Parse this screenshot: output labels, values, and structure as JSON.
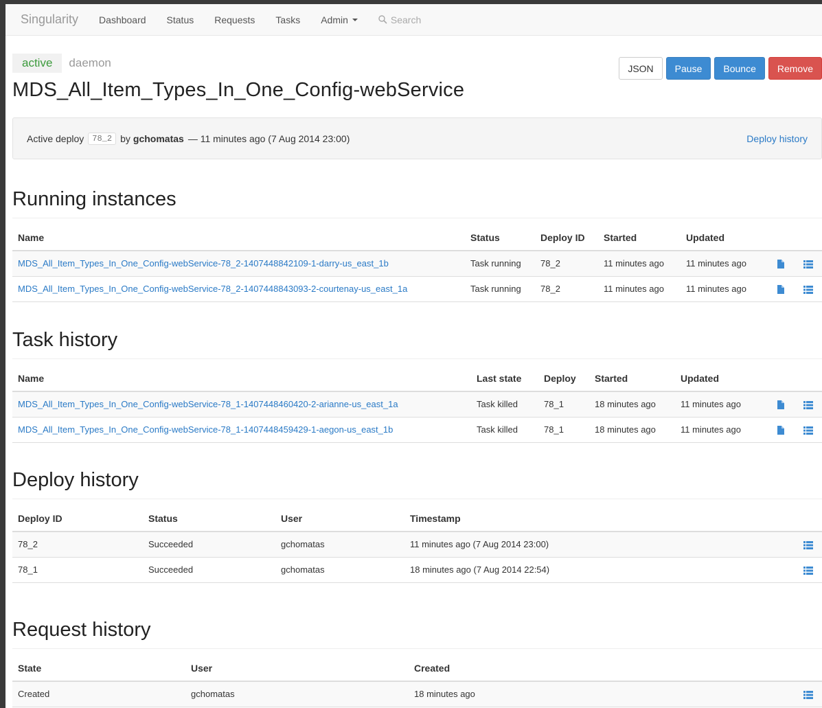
{
  "nav": {
    "brand": "Singularity",
    "items": [
      "Dashboard",
      "Status",
      "Requests",
      "Tasks"
    ],
    "admin": "Admin",
    "search_placeholder": "Search"
  },
  "header": {
    "state_tag": "active",
    "type_tag": "daemon",
    "title": "MDS_All_Item_Types_In_One_Config-webService",
    "buttons": {
      "json": "JSON",
      "pause": "Pause",
      "bounce": "Bounce",
      "remove": "Remove"
    }
  },
  "active_deploy": {
    "prefix": "Active deploy",
    "deploy_id": "78_2",
    "by": "by",
    "user": "gchomatas",
    "time": "— 11 minutes ago (7 Aug 2014 23:00)",
    "history_link": "Deploy history"
  },
  "running": {
    "title": "Running instances",
    "headers": [
      "Name",
      "Status",
      "Deploy ID",
      "Started",
      "Updated"
    ],
    "rows": [
      [
        "MDS_All_Item_Types_In_One_Config-webService-78_2-1407448842109-1-darry-us_east_1b",
        "Task running",
        "78_2",
        "11 minutes ago",
        "11 minutes ago"
      ],
      [
        "MDS_All_Item_Types_In_One_Config-webService-78_2-1407448843093-2-courtenay-us_east_1a",
        "Task running",
        "78_2",
        "11 minutes ago",
        "11 minutes ago"
      ]
    ]
  },
  "task_history": {
    "title": "Task history",
    "headers": [
      "Name",
      "Last state",
      "Deploy",
      "Started",
      "Updated"
    ],
    "rows": [
      [
        "MDS_All_Item_Types_In_One_Config-webService-78_1-1407448460420-2-arianne-us_east_1a",
        "Task killed",
        "78_1",
        "18 minutes ago",
        "11 minutes ago"
      ],
      [
        "MDS_All_Item_Types_In_One_Config-webService-78_1-1407448459429-1-aegon-us_east_1b",
        "Task killed",
        "78_1",
        "18 minutes ago",
        "11 minutes ago"
      ]
    ]
  },
  "deploy_history": {
    "title": "Deploy history",
    "headers": [
      "Deploy ID",
      "Status",
      "User",
      "Timestamp"
    ],
    "rows": [
      [
        "78_2",
        "Succeeded",
        "gchomatas",
        "11 minutes ago (7 Aug 2014 23:00)"
      ],
      [
        "78_1",
        "Succeeded",
        "gchomatas",
        "18 minutes ago (7 Aug 2014 22:54)"
      ]
    ]
  },
  "request_history": {
    "title": "Request history",
    "headers": [
      "State",
      "User",
      "Created"
    ],
    "rows": [
      [
        "Created",
        "gchomatas",
        "18 minutes ago"
      ]
    ]
  },
  "colors": {
    "link": "#2a7ac6",
    "primary": "#3d8bd2",
    "danger": "#d9534f",
    "active": "#3c9a3c"
  },
  "icons": {
    "file": "file-icon",
    "list": "list-icon",
    "search": "search-icon"
  }
}
